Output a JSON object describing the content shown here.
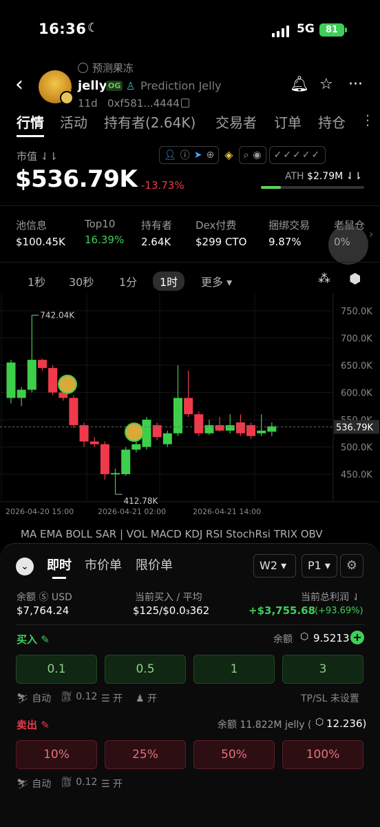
{
  "status": {
    "time": "16:36",
    "network": "5G",
    "battery": "81"
  },
  "header": {
    "prediction_tag": "预测果冻",
    "token_symbol": "jelly",
    "og_badge": "OG",
    "token_fullname": "Prediction Jelly",
    "age": "11d",
    "address": "0xf581...4444"
  },
  "tabs": [
    "行情",
    "活动",
    "持有者(2.64K)",
    "交易者",
    "订单",
    "持仓"
  ],
  "market": {
    "label": "市值 ⇃⇂",
    "value": "$536.79K",
    "change": "-13.73%",
    "ath_label": "ATH",
    "ath_value": "$2.79M ⇃⇂",
    "ath_progress": 0.19
  },
  "info": [
    {
      "label": "池信息",
      "value": "$100.45K"
    },
    {
      "label": "Top10",
      "value": "16.39%"
    },
    {
      "label": "持有者",
      "value": "2.64K"
    },
    {
      "label": "Dex付费",
      "value": "$299 CTO"
    },
    {
      "label": "捆绑交易",
      "value": "9.87%"
    },
    {
      "label": "老鼠仓",
      "value": "0%"
    }
  ],
  "timeframes": {
    "t1": "1秒",
    "t2": "30秒",
    "t3": "1分",
    "t4": "1时",
    "more": "更多 ▾"
  },
  "chart_data": {
    "type": "candlestick",
    "y_ticks": [
      "750.0K",
      "700.0K",
      "650.0K",
      "600.0K",
      "550.0K",
      "500.0K",
      "450.0K"
    ],
    "ylim": [
      420,
      760
    ],
    "x_ticks": [
      "2026-04-20 15:00",
      "2026-04-21 02:00",
      "2026-04-21 14:00"
    ],
    "current_price": "536.79K",
    "high_label": "742.04K",
    "low_label": "412.78K",
    "candles": [
      {
        "o": 590,
        "c": 655,
        "h": 660,
        "l": 580
      },
      {
        "o": 590,
        "c": 605,
        "h": 610,
        "l": 575
      },
      {
        "o": 605,
        "c": 660,
        "h": 742,
        "l": 600
      },
      {
        "o": 660,
        "c": 645,
        "h": 662,
        "l": 640
      },
      {
        "o": 645,
        "c": 600,
        "h": 650,
        "l": 595
      },
      {
        "o": 600,
        "c": 590,
        "h": 605,
        "l": 585
      },
      {
        "o": 590,
        "c": 540,
        "h": 595,
        "l": 535
      },
      {
        "o": 540,
        "c": 510,
        "h": 545,
        "l": 500
      },
      {
        "o": 510,
        "c": 505,
        "h": 518,
        "l": 500
      },
      {
        "o": 505,
        "c": 450,
        "h": 510,
        "l": 440
      },
      {
        "o": 450,
        "c": 452,
        "h": 460,
        "l": 413
      },
      {
        "o": 450,
        "c": 495,
        "h": 500,
        "l": 447
      },
      {
        "o": 495,
        "c": 505,
        "h": 510,
        "l": 490
      },
      {
        "o": 500,
        "c": 550,
        "h": 555,
        "l": 495
      },
      {
        "o": 540,
        "c": 518,
        "h": 545,
        "l": 512
      },
      {
        "o": 505,
        "c": 525,
        "h": 530,
        "l": 500
      },
      {
        "o": 525,
        "c": 590,
        "h": 650,
        "l": 520
      },
      {
        "o": 590,
        "c": 560,
        "h": 640,
        "l": 555
      },
      {
        "o": 560,
        "c": 525,
        "h": 565,
        "l": 520
      },
      {
        "o": 525,
        "c": 540,
        "h": 550,
        "l": 522
      },
      {
        "o": 540,
        "c": 530,
        "h": 555,
        "l": 528
      },
      {
        "o": 530,
        "c": 540,
        "h": 560,
        "l": 525
      },
      {
        "o": 545,
        "c": 525,
        "h": 560,
        "l": 520
      },
      {
        "o": 540,
        "c": 520,
        "h": 545,
        "l": 515
      },
      {
        "o": 525,
        "c": 530,
        "h": 560,
        "l": 520
      },
      {
        "o": 528,
        "c": 538,
        "h": 545,
        "l": 520
      }
    ],
    "colors": {
      "up": "#3ecf4a",
      "down": "#f03a4b"
    }
  },
  "indicators": "MA  EMA  BOLL  SAR  |  VOL  MACD  KDJ  RSI  StochRsi  TRIX  OBV",
  "panel": {
    "tabs": {
      "t1": "即时",
      "t2": "市价单",
      "t3": "限价单"
    },
    "wallet_select": "W2 ▾",
    "preset_select": "P1 ▾",
    "balance_label": "余额 Ⓢ USD",
    "balance_value": "$7,764.24",
    "buy_avg_label": "当前买入 / 平均",
    "buy_avg_value": "$125/$0.0₃362",
    "pnl_label": "当前总利润 ⇃",
    "pnl_value": "+$3,755.68",
    "pnl_pct": "(+93.69%)",
    "buy_label": "买入 ✎",
    "buy_balance_label": "余额",
    "buy_balance_value": "9.5213",
    "buy_amounts": [
      "0.1",
      "0.5",
      "1",
      "3"
    ],
    "buy_opts": {
      "auto": "自动",
      "fee": "0.12",
      "mev": "开",
      "prio": "开"
    },
    "tpsl": "TP/SL 未设置",
    "sell_label": "卖出 ✎",
    "sell_balance": "余额 11.822M jelly (",
    "sell_balance_value": "12.236)",
    "sell_pcts": [
      "10%",
      "25%",
      "50%",
      "100%"
    ],
    "sell_opts": {
      "auto": "自动",
      "fee": "0.12",
      "mev": "开"
    }
  }
}
